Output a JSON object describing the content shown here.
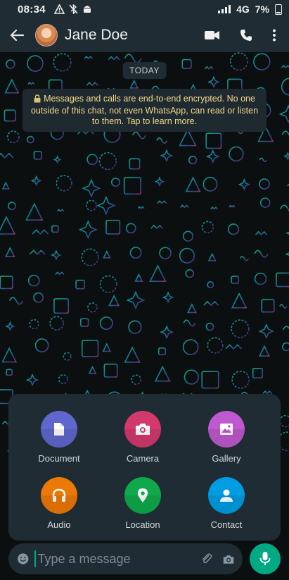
{
  "status_bar": {
    "time": "08:34",
    "network": "4G",
    "battery": "7%",
    "left_icons": [
      "warning-icon",
      "bluetooth-off-icon",
      "android-icon"
    ]
  },
  "header": {
    "contact_name": "Jane Doe",
    "actions": [
      "video-call-icon",
      "voice-call-icon",
      "more-options-icon"
    ]
  },
  "chat": {
    "date_chip": "TODAY",
    "encryption_notice": "Messages and calls are end-to-end encrypted. No one outside of this chat, not even WhatsApp, can read or listen to them. Tap to learn more."
  },
  "attachments": [
    {
      "label": "Document",
      "color": "#5f66cd"
    },
    {
      "label": "Camera",
      "color": "#d3396d"
    },
    {
      "label": "Gallery",
      "color": "#bf59cf"
    },
    {
      "label": "Audio",
      "color": "#ec7905"
    },
    {
      "label": "Location",
      "color": "#0fa94b"
    },
    {
      "label": "Contact",
      "color": "#009de2"
    }
  ],
  "composer": {
    "placeholder": "Type a message",
    "accent": "#00a884"
  }
}
